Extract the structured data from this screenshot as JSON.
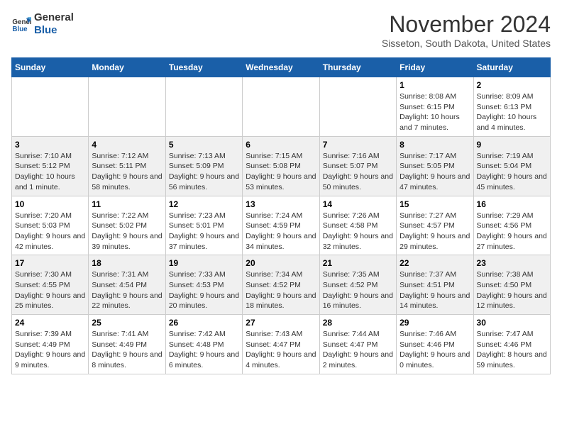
{
  "logo": {
    "line1": "General",
    "line2": "Blue"
  },
  "header": {
    "title": "November 2024",
    "subtitle": "Sisseton, South Dakota, United States"
  },
  "weekdays": [
    "Sunday",
    "Monday",
    "Tuesday",
    "Wednesday",
    "Thursday",
    "Friday",
    "Saturday"
  ],
  "weeks": [
    [
      {
        "day": "",
        "info": ""
      },
      {
        "day": "",
        "info": ""
      },
      {
        "day": "",
        "info": ""
      },
      {
        "day": "",
        "info": ""
      },
      {
        "day": "",
        "info": ""
      },
      {
        "day": "1",
        "info": "Sunrise: 8:08 AM\nSunset: 6:15 PM\nDaylight: 10 hours and 7 minutes."
      },
      {
        "day": "2",
        "info": "Sunrise: 8:09 AM\nSunset: 6:13 PM\nDaylight: 10 hours and 4 minutes."
      }
    ],
    [
      {
        "day": "3",
        "info": "Sunrise: 7:10 AM\nSunset: 5:12 PM\nDaylight: 10 hours and 1 minute."
      },
      {
        "day": "4",
        "info": "Sunrise: 7:12 AM\nSunset: 5:11 PM\nDaylight: 9 hours and 58 minutes."
      },
      {
        "day": "5",
        "info": "Sunrise: 7:13 AM\nSunset: 5:09 PM\nDaylight: 9 hours and 56 minutes."
      },
      {
        "day": "6",
        "info": "Sunrise: 7:15 AM\nSunset: 5:08 PM\nDaylight: 9 hours and 53 minutes."
      },
      {
        "day": "7",
        "info": "Sunrise: 7:16 AM\nSunset: 5:07 PM\nDaylight: 9 hours and 50 minutes."
      },
      {
        "day": "8",
        "info": "Sunrise: 7:17 AM\nSunset: 5:05 PM\nDaylight: 9 hours and 47 minutes."
      },
      {
        "day": "9",
        "info": "Sunrise: 7:19 AM\nSunset: 5:04 PM\nDaylight: 9 hours and 45 minutes."
      }
    ],
    [
      {
        "day": "10",
        "info": "Sunrise: 7:20 AM\nSunset: 5:03 PM\nDaylight: 9 hours and 42 minutes."
      },
      {
        "day": "11",
        "info": "Sunrise: 7:22 AM\nSunset: 5:02 PM\nDaylight: 9 hours and 39 minutes."
      },
      {
        "day": "12",
        "info": "Sunrise: 7:23 AM\nSunset: 5:01 PM\nDaylight: 9 hours and 37 minutes."
      },
      {
        "day": "13",
        "info": "Sunrise: 7:24 AM\nSunset: 4:59 PM\nDaylight: 9 hours and 34 minutes."
      },
      {
        "day": "14",
        "info": "Sunrise: 7:26 AM\nSunset: 4:58 PM\nDaylight: 9 hours and 32 minutes."
      },
      {
        "day": "15",
        "info": "Sunrise: 7:27 AM\nSunset: 4:57 PM\nDaylight: 9 hours and 29 minutes."
      },
      {
        "day": "16",
        "info": "Sunrise: 7:29 AM\nSunset: 4:56 PM\nDaylight: 9 hours and 27 minutes."
      }
    ],
    [
      {
        "day": "17",
        "info": "Sunrise: 7:30 AM\nSunset: 4:55 PM\nDaylight: 9 hours and 25 minutes."
      },
      {
        "day": "18",
        "info": "Sunrise: 7:31 AM\nSunset: 4:54 PM\nDaylight: 9 hours and 22 minutes."
      },
      {
        "day": "19",
        "info": "Sunrise: 7:33 AM\nSunset: 4:53 PM\nDaylight: 9 hours and 20 minutes."
      },
      {
        "day": "20",
        "info": "Sunrise: 7:34 AM\nSunset: 4:52 PM\nDaylight: 9 hours and 18 minutes."
      },
      {
        "day": "21",
        "info": "Sunrise: 7:35 AM\nSunset: 4:52 PM\nDaylight: 9 hours and 16 minutes."
      },
      {
        "day": "22",
        "info": "Sunrise: 7:37 AM\nSunset: 4:51 PM\nDaylight: 9 hours and 14 minutes."
      },
      {
        "day": "23",
        "info": "Sunrise: 7:38 AM\nSunset: 4:50 PM\nDaylight: 9 hours and 12 minutes."
      }
    ],
    [
      {
        "day": "24",
        "info": "Sunrise: 7:39 AM\nSunset: 4:49 PM\nDaylight: 9 hours and 9 minutes."
      },
      {
        "day": "25",
        "info": "Sunrise: 7:41 AM\nSunset: 4:49 PM\nDaylight: 9 hours and 8 minutes."
      },
      {
        "day": "26",
        "info": "Sunrise: 7:42 AM\nSunset: 4:48 PM\nDaylight: 9 hours and 6 minutes."
      },
      {
        "day": "27",
        "info": "Sunrise: 7:43 AM\nSunset: 4:47 PM\nDaylight: 9 hours and 4 minutes."
      },
      {
        "day": "28",
        "info": "Sunrise: 7:44 AM\nSunset: 4:47 PM\nDaylight: 9 hours and 2 minutes."
      },
      {
        "day": "29",
        "info": "Sunrise: 7:46 AM\nSunset: 4:46 PM\nDaylight: 9 hours and 0 minutes."
      },
      {
        "day": "30",
        "info": "Sunrise: 7:47 AM\nSunset: 4:46 PM\nDaylight: 8 hours and 59 minutes."
      }
    ]
  ]
}
